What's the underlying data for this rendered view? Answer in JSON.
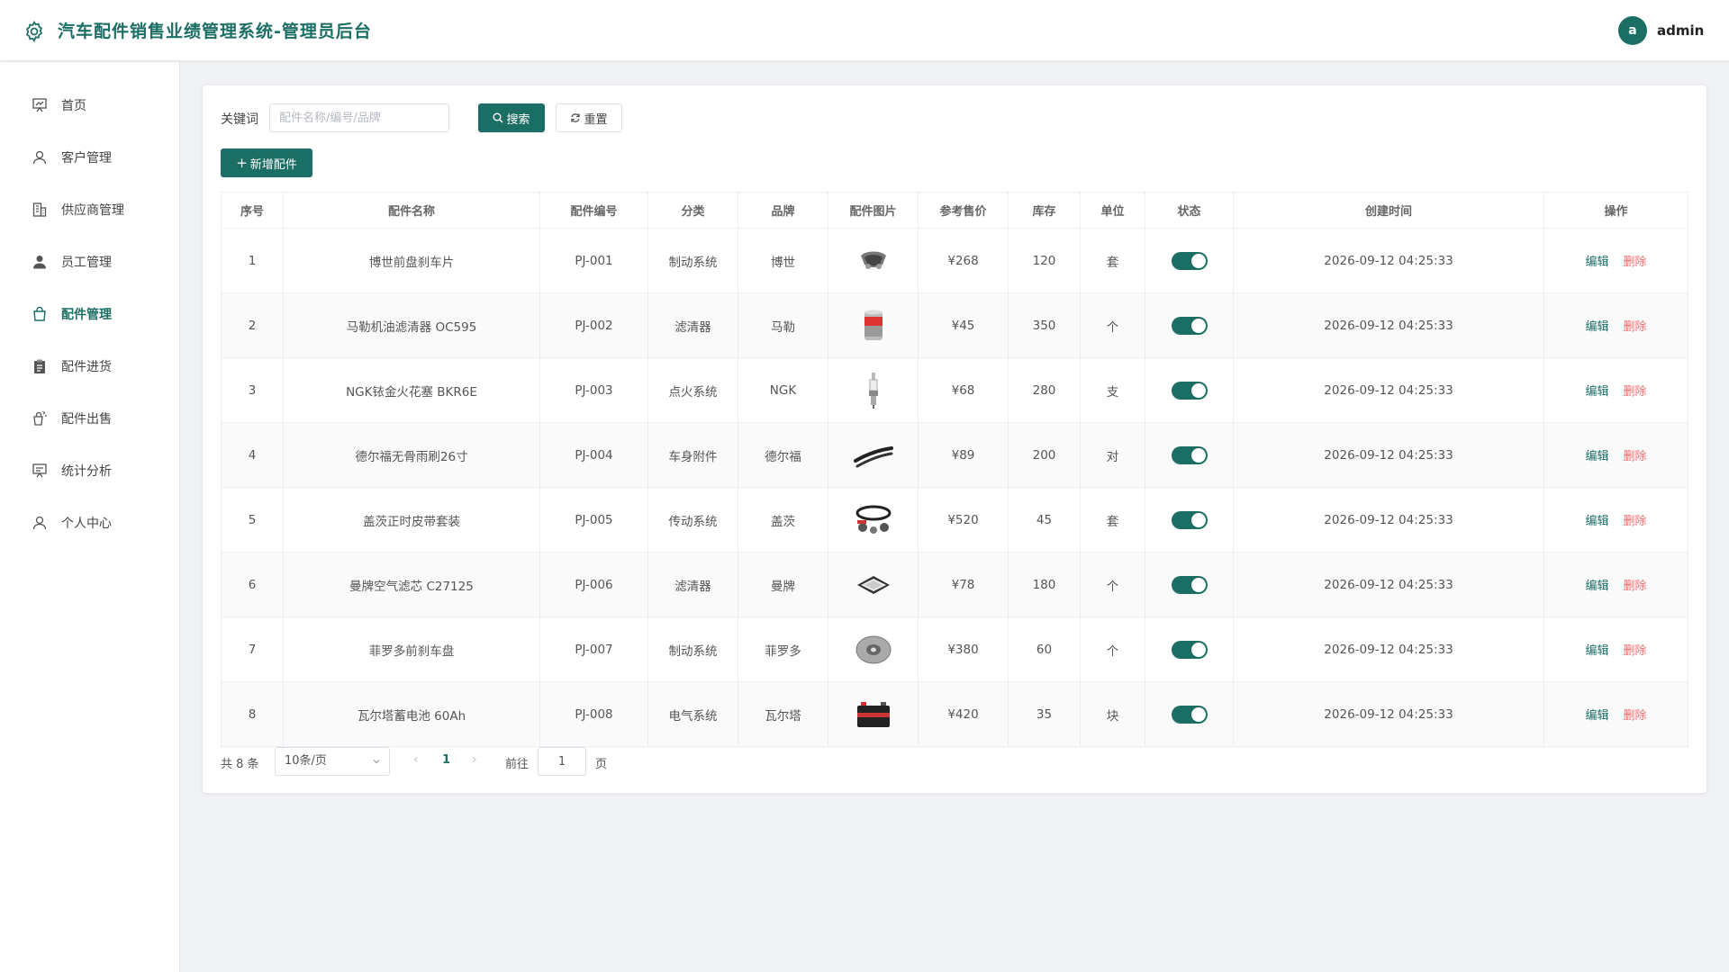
{
  "header": {
    "title": "汽车配件销售业绩管理系统-管理员后台",
    "avatar_letter": "a",
    "user": "admin"
  },
  "sidebar": {
    "items": [
      {
        "label": "首页",
        "icon": "dashboard-icon"
      },
      {
        "label": "客户管理",
        "icon": "user-icon"
      },
      {
        "label": "供应商管理",
        "icon": "building-icon"
      },
      {
        "label": "员工管理",
        "icon": "person-filled-icon"
      },
      {
        "label": "配件管理",
        "icon": "shopping-bag-icon",
        "active": true
      },
      {
        "label": "配件进货",
        "icon": "clipboard-icon"
      },
      {
        "label": "配件出售",
        "icon": "sell-icon"
      },
      {
        "label": "统计分析",
        "icon": "chart-board-icon"
      },
      {
        "label": "个人中心",
        "icon": "user-icon"
      }
    ]
  },
  "search": {
    "label": "关键词",
    "placeholder": "配件名称/编号/品牌",
    "search_label": "搜索",
    "reset_label": "重置",
    "add_label": "新增配件"
  },
  "table": {
    "columns": [
      "序号",
      "配件名称",
      "配件编号",
      "分类",
      "品牌",
      "配件图片",
      "参考售价",
      "库存",
      "单位",
      "状态",
      "创建时间",
      "操作"
    ],
    "edit_label": "编辑",
    "delete_label": "删除",
    "rows": [
      {
        "no": "1",
        "name": "博世前盘刹车片",
        "code": "PJ-001",
        "category": "制动系统",
        "brand": "博世",
        "image": "brake-pad",
        "price": "¥268",
        "stock": "120",
        "unit": "套",
        "enabled": true,
        "created": "2026-09-12 04:25:33"
      },
      {
        "no": "2",
        "name": "马勒机油滤清器 OC595",
        "code": "PJ-002",
        "category": "滤清器",
        "brand": "马勒",
        "image": "oil-filter",
        "price": "¥45",
        "stock": "350",
        "unit": "个",
        "enabled": true,
        "created": "2026-09-12 04:25:33"
      },
      {
        "no": "3",
        "name": "NGK铱金火花塞 BKR6E",
        "code": "PJ-003",
        "category": "点火系统",
        "brand": "NGK",
        "image": "spark-plug",
        "price": "¥68",
        "stock": "280",
        "unit": "支",
        "enabled": true,
        "created": "2026-09-12 04:25:33"
      },
      {
        "no": "4",
        "name": "德尔福无骨雨刷26寸",
        "code": "PJ-004",
        "category": "车身附件",
        "brand": "德尔福",
        "image": "wiper",
        "price": "¥89",
        "stock": "200",
        "unit": "对",
        "enabled": true,
        "created": "2026-09-12 04:25:33"
      },
      {
        "no": "5",
        "name": "盖茨正时皮带套装",
        "code": "PJ-005",
        "category": "传动系统",
        "brand": "盖茨",
        "image": "timing-belt",
        "price": "¥520",
        "stock": "45",
        "unit": "套",
        "enabled": true,
        "created": "2026-09-12 04:25:33"
      },
      {
        "no": "6",
        "name": "曼牌空气滤芯 C27125",
        "code": "PJ-006",
        "category": "滤清器",
        "brand": "曼牌",
        "image": "air-filter",
        "price": "¥78",
        "stock": "180",
        "unit": "个",
        "enabled": true,
        "created": "2026-09-12 04:25:33"
      },
      {
        "no": "7",
        "name": "菲罗多前刹车盘",
        "code": "PJ-007",
        "category": "制动系统",
        "brand": "菲罗多",
        "image": "brake-disc",
        "price": "¥380",
        "stock": "60",
        "unit": "个",
        "enabled": true,
        "created": "2026-09-12 04:25:33"
      },
      {
        "no": "8",
        "name": "瓦尔塔蓄电池 60Ah",
        "code": "PJ-008",
        "category": "电气系统",
        "brand": "瓦尔塔",
        "image": "battery",
        "price": "¥420",
        "stock": "35",
        "unit": "块",
        "enabled": true,
        "created": "2026-09-12 04:25:33"
      }
    ]
  },
  "pagination": {
    "total": "共 8 条",
    "page_size": "10条/页",
    "current": "1",
    "goto_label": "前往",
    "goto_value": "1",
    "page_label": "页"
  },
  "colors": {
    "primary": "#1b6e64",
    "danger": "#f56c6c"
  }
}
